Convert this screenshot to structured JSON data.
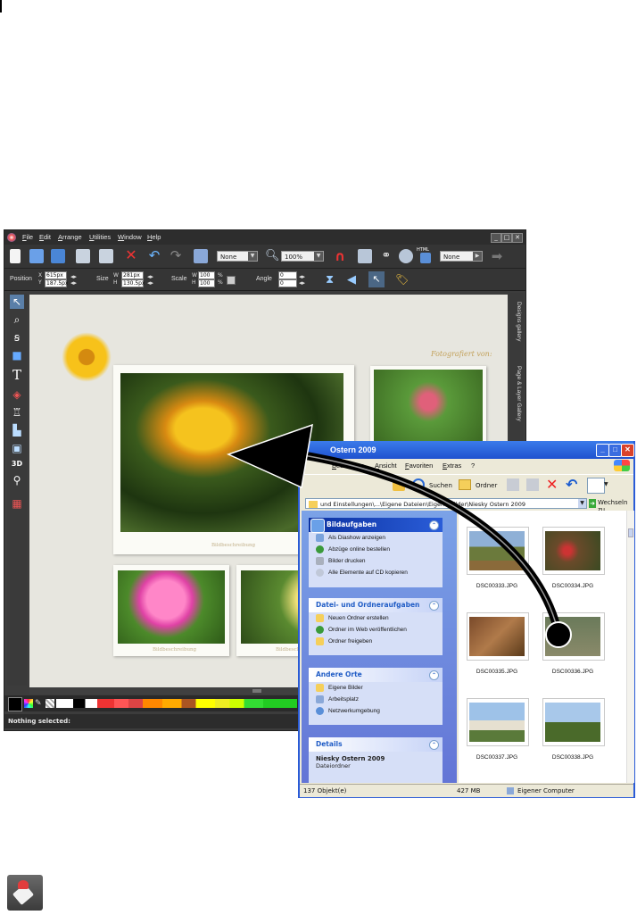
{
  "xara": {
    "menu": [
      "File",
      "Edit",
      "Arrange",
      "Utilities",
      "Window",
      "Help"
    ],
    "window_buttons": [
      "_",
      "□",
      "✕"
    ],
    "toolbar1": {
      "dropdown_none": "None",
      "zoom_value": "100%",
      "html_label": "HTML",
      "dropdown_none2": "None"
    },
    "toolbar2": {
      "position_label": "Position",
      "x_label": "X",
      "y_label": "Y",
      "x_value": "615px",
      "y_value": "187.5px",
      "size_label": "Size",
      "w_label": "W",
      "h_label": "H",
      "w_value": "281px",
      "h_value": "130.5px",
      "scale_label": "Scale",
      "scale_w": "100",
      "scale_h": "100",
      "percent": "%",
      "angle_label": "Angle",
      "angle_1": "0",
      "angle_2": "0"
    },
    "gallery_tabs": [
      "Designs gallery",
      "Page & Layer Gallery"
    ],
    "canvas": {
      "photographer_label": "Fotografiert von:",
      "caption": "Bildbeschreibung"
    },
    "status": "Nothing selected:"
  },
  "explorer": {
    "title": "Ostern 2009",
    "menu": [
      "Bearbeiten",
      "Ansicht",
      "Favoriten",
      "Extras",
      "?"
    ],
    "toolbar": {
      "search": "Suchen",
      "folders": "Ordner"
    },
    "address": "und Einstellungen\\...\\Eigene Dateien\\Eigene Bilder\\Niesky Ostern 2009",
    "go_label": "Wechseln zu",
    "task_groups": {
      "picture_tasks": {
        "title": "Bildaufgaben",
        "items": [
          "Als Diashow anzeigen",
          "Abzüge online bestellen",
          "Bilder drucken",
          "Alle Elemente auf CD kopieren"
        ]
      },
      "file_tasks": {
        "title": "Datei- und Ordneraufgaben",
        "items": [
          "Neuen Ordner erstellen",
          "Ordner im Web veröffentlichen",
          "Ordner freigeben"
        ]
      },
      "other_places": {
        "title": "Andere Orte",
        "items": [
          "Eigene Bilder",
          "Arbeitsplatz",
          "Netzwerkumgebung"
        ]
      },
      "details": {
        "title": "Details",
        "name": "Niesky Ostern 2009",
        "type": "Dateiordner"
      }
    },
    "files": [
      "DSC00333.JPG",
      "DSC00334.JPG",
      "DSC00335.JPG",
      "DSC00336.JPG",
      "DSC00337.JPG",
      "DSC00338.JPG"
    ],
    "status": {
      "count": "137 Objekt(e)",
      "size": "427 MB",
      "location": "Eigener Computer"
    }
  },
  "colors": {
    "xp_blue": "#1f52cf",
    "xara_dark": "#3c3c3c",
    "arrow": "#000000"
  }
}
